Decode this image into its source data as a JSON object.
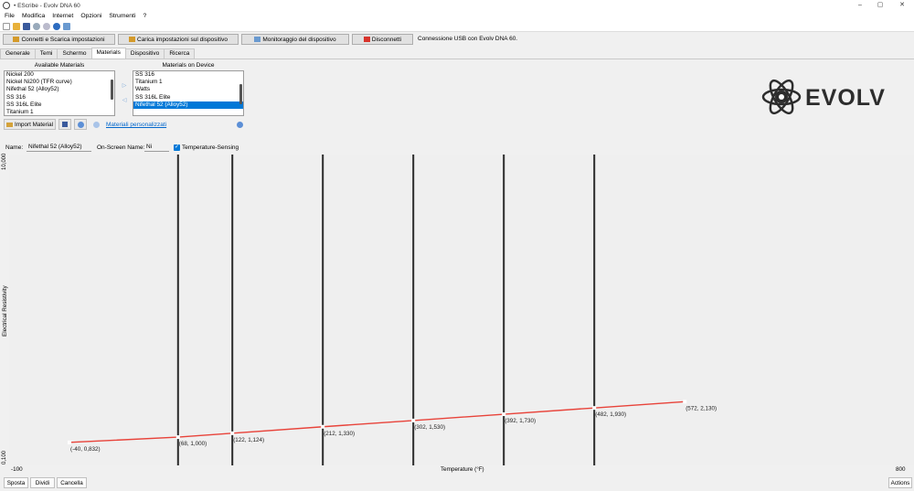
{
  "window": {
    "title": "• EScribe - Evolv DNA 60",
    "controls": [
      "–",
      "▢",
      "✕"
    ]
  },
  "menu": [
    "File",
    "Modifica",
    "Internet",
    "Opzioni",
    "Strumenti",
    "?"
  ],
  "actions": {
    "connect": "Connetti e Scarica impostazioni",
    "upload": "Carica impostazioni sul dispositivo",
    "monitor": "Monitoraggio del dispositivo",
    "disconnect": "Disconnetti",
    "status": "Connessione USB con Evolv DNA 60."
  },
  "tabs": [
    "Generale",
    "Temi",
    "Schermo",
    "Materials",
    "Dispositivo",
    "Ricerca"
  ],
  "active_tab": "Materials",
  "materials": {
    "available_title": "Available Materials",
    "available": [
      "Nickel 200",
      "Nickel Ni200 (TFR curve)",
      "Nifethal 52 (Alloy52)",
      "SS 316",
      "SS 316L Elite",
      "Titanium 1"
    ],
    "device_title": "Materials on Device",
    "device": [
      "SS 316",
      "Titanium 1",
      "Watts",
      "SS 316L Elite",
      "Nifethal 52 (Alloy52)"
    ],
    "device_selected_index": 4,
    "add_arrow": "▷",
    "remove_arrow": "◁",
    "import_label": "Import Material",
    "custom_link": "Materiali personalizzati"
  },
  "editor": {
    "name_label": "Name:",
    "name_value": "Nifethal 52 (Alloy52)",
    "onscreen_label": "On-Screen Name:",
    "onscreen_value": "Ni",
    "temp_sensing_label": "Temperature-Sensing",
    "temp_sensing_checked": true
  },
  "logo_text": "EVOLV",
  "chart_data": {
    "type": "line",
    "xlabel": "Temperature (°F)",
    "ylabel": "Electrical Resistivity",
    "xlim": [
      -100,
      800
    ],
    "ylim": [
      100,
      10000
    ],
    "x_min_label": "-100",
    "x_max_label": "800",
    "y_min_label": "0,100",
    "y_max_label": "10,000",
    "line_color": "#e8433a",
    "points": [
      {
        "x": -40,
        "y": 832,
        "label": "(-40, 0,832)"
      },
      {
        "x": 68,
        "y": 1000,
        "label": "(68, 1,000)"
      },
      {
        "x": 122,
        "y": 1124,
        "label": "(122, 1,124)"
      },
      {
        "x": 212,
        "y": 1330,
        "label": "(212, 1,330)"
      },
      {
        "x": 302,
        "y": 1530,
        "label": "(302, 1,530)"
      },
      {
        "x": 392,
        "y": 1730,
        "label": "(392, 1,730)"
      },
      {
        "x": 482,
        "y": 1930,
        "label": "(482, 1,930)"
      },
      {
        "x": 572,
        "y": 2130,
        "label": "(572, 2,130)"
      }
    ],
    "guide_lines_at_x": [
      68,
      122,
      212,
      302,
      392,
      482
    ]
  },
  "bottom": {
    "move": "Sposta",
    "split": "Dividi",
    "delete": "Cancella",
    "actions": "Actions"
  }
}
